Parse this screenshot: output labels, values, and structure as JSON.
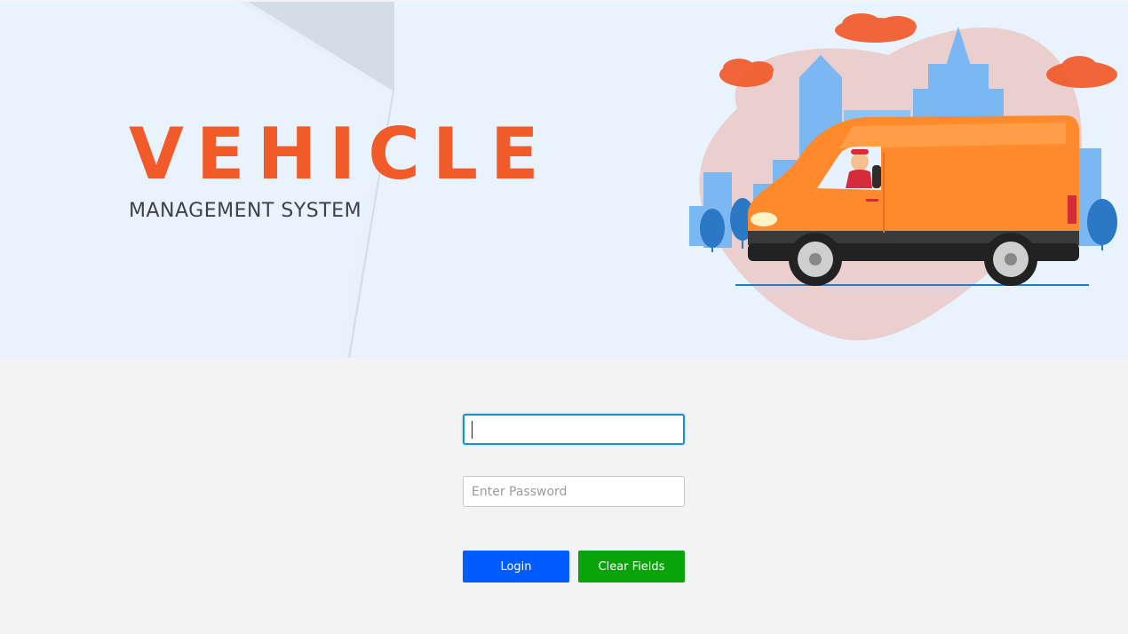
{
  "banner": {
    "title": "VEHICLE",
    "subtitle": "MANAGEMENT SYSTEM",
    "illustration_icon": "delivery-van-city-illustration"
  },
  "form": {
    "username": {
      "value": "",
      "placeholder": ""
    },
    "password": {
      "value": "",
      "placeholder": "Enter Password"
    },
    "login_label": "Login",
    "clear_label": "Clear Fields"
  },
  "colors": {
    "brand": "#f15a29",
    "login_button": "#005cff",
    "clear_button": "#0aa30a",
    "focus_border": "#1b8fcf",
    "page_background": "#f3f3f3",
    "banner_background": "#e9f3fd"
  }
}
